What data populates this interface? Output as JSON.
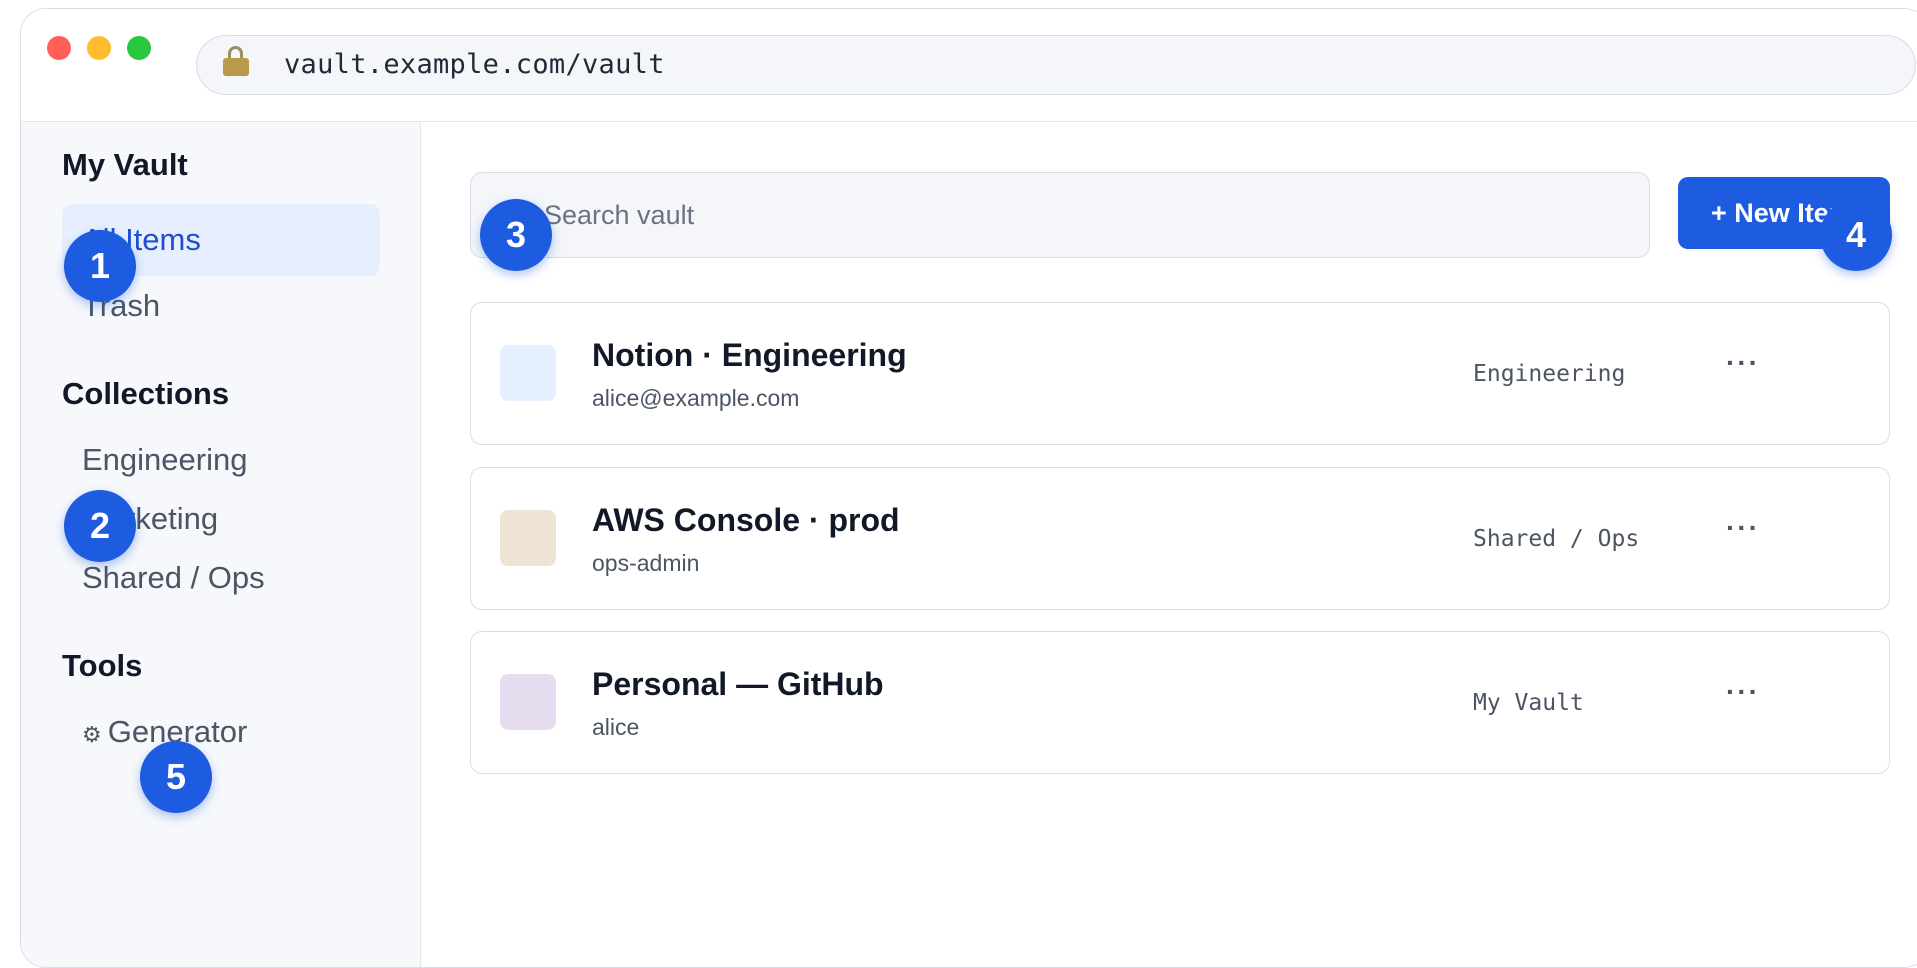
{
  "browser": {
    "url": "vault.example.com/vault"
  },
  "sidebar": {
    "my_vault_title": "My Vault",
    "my_vault_items": [
      {
        "label": "All Items"
      },
      {
        "label": "Trash"
      }
    ],
    "collections_title": "Collections",
    "collections": [
      {
        "label": "Engineering"
      },
      {
        "label": "Marketing"
      },
      {
        "label": "Shared / Ops"
      }
    ],
    "tools_title": "Tools",
    "tools": [
      {
        "label": "Generator",
        "icon": "gear-icon"
      }
    ]
  },
  "main": {
    "search_placeholder": "Search vault",
    "new_item_label": "+ New Item",
    "items": [
      {
        "title": "Notion · Engineering",
        "subtitle": "alice@example.com",
        "collection": "Engineering",
        "more": "···",
        "icon_color": "#e6effd"
      },
      {
        "title": "AWS Console · prod",
        "subtitle": "ops-admin",
        "collection": "Shared / Ops",
        "more": "···",
        "icon_color": "#efe3d6"
      },
      {
        "title": "Personal — GitHub",
        "subtitle": "alice",
        "collection": "My Vault",
        "more": "···",
        "icon_color": "#e6dcef"
      }
    ]
  },
  "annotations": [
    "1",
    "2",
    "3",
    "4",
    "5"
  ],
  "colors": {
    "accent": "#1d5be0",
    "active_nav_bg": "#e7efff"
  }
}
